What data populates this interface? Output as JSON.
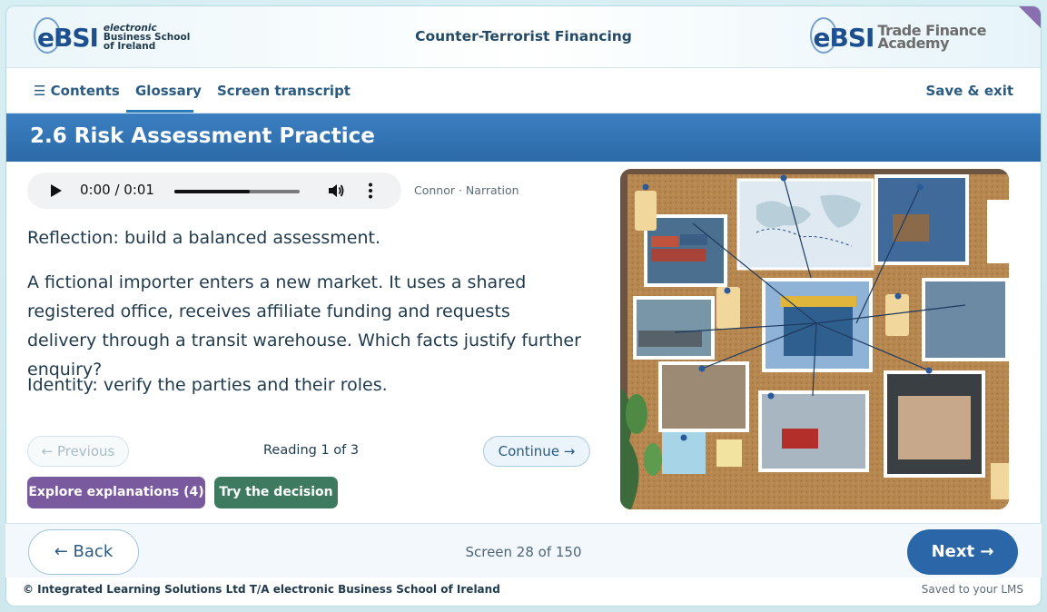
{
  "header": {
    "left_logo": {
      "mark": "eBSI",
      "line1": "electronic",
      "line2": "Business School",
      "line3": "of Ireland"
    },
    "course_title": "Counter-Terrorist Financing",
    "right_logo": {
      "mark": "eBSI",
      "line1": "Trade Finance",
      "line2": "Academy"
    }
  },
  "nav": {
    "contents": "☰ Contents",
    "glossary": "Glossary",
    "transcript": "Screen transcript",
    "save_exit": "Save & exit"
  },
  "page_title": "2.6 Risk Assessment Practice",
  "audio": {
    "time": "0:00 / 0:01",
    "progress": 0.6,
    "speaker": "Connor · Narration"
  },
  "content": {
    "p1": "Reflection: build a balanced assessment.",
    "p2": "A fictional importer enters a new market. It uses a shared registered office, receives affiliate funding and requests delivery through a transit warehouse. Which facts justify further enquiry?",
    "p3": "Identity: verify the parties and their roles."
  },
  "reading": {
    "previous": "← Previous",
    "status": "Reading 1 of 3",
    "continue": "Continue →"
  },
  "actions": {
    "explore": "Explore explanations (4)",
    "decision": "Try the decision"
  },
  "footer": {
    "back": "← Back",
    "screen": "Screen 28 of 150",
    "next": "Next →",
    "copyright": "© Integrated Learning Solutions Ltd T/A electronic Business School of Ireland",
    "saved": "Saved to your LMS"
  },
  "colors": {
    "accent": "#2a66a8",
    "title_bar": "#3b7fc1",
    "explore": "#7a5a9e",
    "decision": "#3d7a60"
  }
}
